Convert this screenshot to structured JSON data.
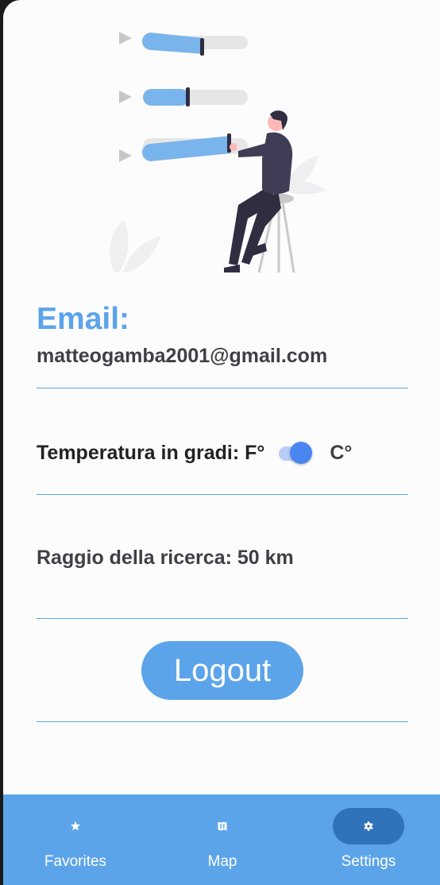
{
  "profile": {
    "email_label": "Email:",
    "email_value": "matteogamba2001@gmail.com"
  },
  "settings": {
    "temperature_label": "Temperatura in gradi: F°",
    "temperature_unit": "C°",
    "temperature_toggle_on": true,
    "radius_label": "Raggio della ricerca: 50 km"
  },
  "actions": {
    "logout_label": "Logout"
  },
  "nav": {
    "items": [
      {
        "label": "Favorites",
        "icon": "star-icon",
        "active": false
      },
      {
        "label": "Map",
        "icon": "map-icon",
        "active": false
      },
      {
        "label": "Settings",
        "icon": "gear-icon",
        "active": true
      }
    ]
  },
  "colors": {
    "accent": "#5ca4ea",
    "active_pill": "#2f73bb",
    "toggle_thumb": "#4a86f0"
  }
}
